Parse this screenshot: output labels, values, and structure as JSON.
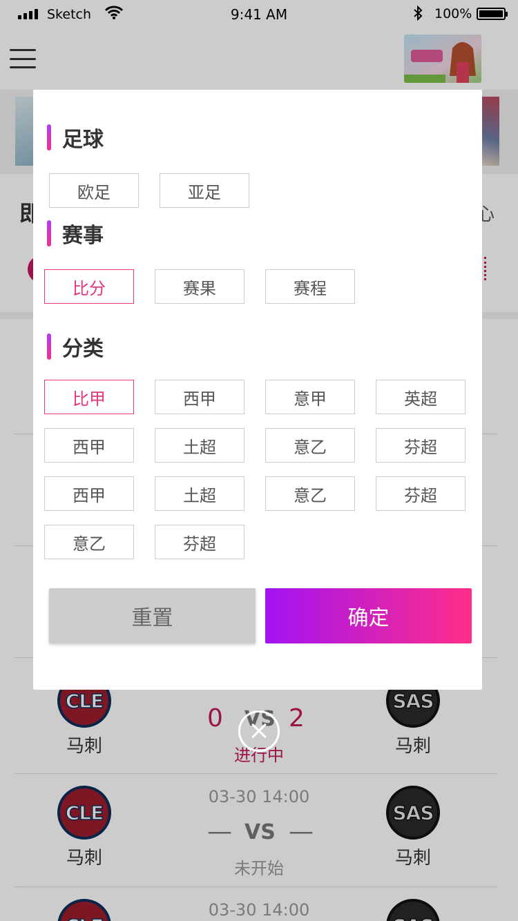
{
  "status_bar": {
    "carrier": "Sketch",
    "time": "9:41 AM",
    "battery": "100%"
  },
  "page": {
    "section_title": "即",
    "section_more": "心"
  },
  "matches": [
    {
      "home": {
        "logo": "CLE",
        "name": "马刺"
      },
      "away": {
        "logo": "SAS",
        "name": "马刺"
      },
      "home_score": "0",
      "away_score": "2",
      "vs": "VS",
      "status": "进行中"
    },
    {
      "time": "03-30 14:00",
      "home": {
        "logo": "CLE",
        "name": "马刺"
      },
      "away": {
        "logo": "SAS",
        "name": "马刺"
      },
      "home_score": "—",
      "away_score": "—",
      "vs": "VS",
      "status": "未开始"
    },
    {
      "time": "03-30 14:00",
      "home": {
        "logo": "CLE"
      },
      "away": {
        "logo": "SAS"
      }
    }
  ],
  "filter": {
    "groups": [
      {
        "title": "足球",
        "options": [
          "欧足",
          "亚足"
        ]
      },
      {
        "title": "赛事",
        "options": [
          "比分",
          "赛果",
          "赛程"
        ],
        "selected": "比分"
      },
      {
        "title": "分类",
        "options": [
          "比甲",
          "西甲",
          "意甲",
          "英超",
          "西甲",
          "土超",
          "意乙",
          "芬超",
          "西甲",
          "土超",
          "意乙",
          "芬超",
          "意乙",
          "芬超"
        ],
        "selected": "比甲"
      }
    ],
    "reset_label": "重置",
    "confirm_label": "确定"
  },
  "colors": {
    "accent": "#e6357f",
    "gradient_start": "#a213f2",
    "gradient_end": "#ff2e89",
    "live_score": "#c2185b"
  }
}
